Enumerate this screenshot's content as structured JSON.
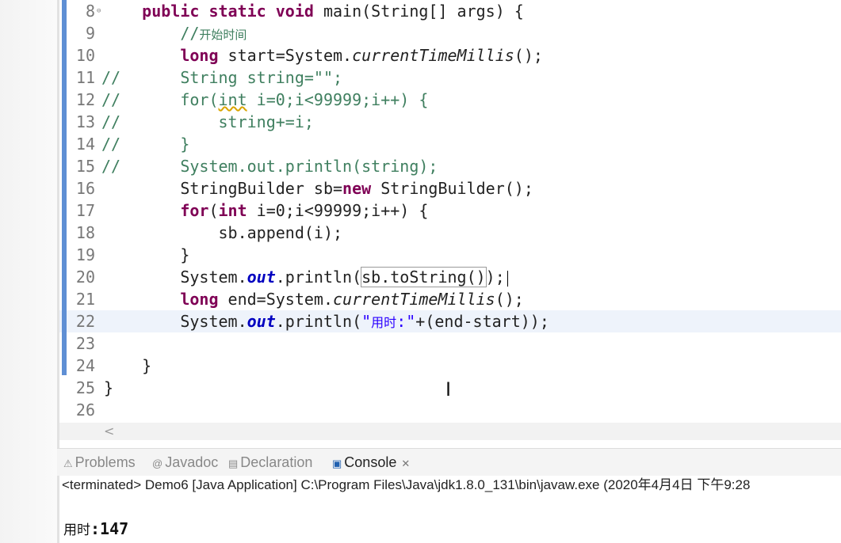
{
  "editor": {
    "lines": [
      {
        "num": "8",
        "marker": "⊖",
        "comment": "",
        "parts": [
          {
            "t": "    "
          },
          {
            "t": "public",
            "c": "kw"
          },
          {
            "t": " "
          },
          {
            "t": "static",
            "c": "kw"
          },
          {
            "t": " "
          },
          {
            "t": "void",
            "c": "kw"
          },
          {
            "t": " main(String[] args) {"
          }
        ]
      },
      {
        "num": "9",
        "comment": "",
        "parts": [
          {
            "t": "        "
          },
          {
            "t": "//",
            "c": "cmt"
          },
          {
            "t": "开始时间",
            "c": "cmt-cn"
          }
        ]
      },
      {
        "num": "10",
        "comment": "",
        "parts": [
          {
            "t": "        "
          },
          {
            "t": "long",
            "c": "kw"
          },
          {
            "t": " start=System."
          },
          {
            "t": "currentTimeMillis",
            "c": "ital"
          },
          {
            "t": "();"
          }
        ]
      },
      {
        "num": "11",
        "comment": "//",
        "parts": [
          {
            "t": "        String string=\"\";",
            "c": "cmt"
          }
        ]
      },
      {
        "num": "12",
        "comment": "//",
        "parts": [
          {
            "t": "        for(",
            "c": "cmt"
          },
          {
            "t": "int",
            "c": "cmt squiggle"
          },
          {
            "t": " i=0;i<99999;i++) {",
            "c": "cmt"
          }
        ]
      },
      {
        "num": "13",
        "comment": "//",
        "parts": [
          {
            "t": "            string+=i;",
            "c": "cmt"
          }
        ]
      },
      {
        "num": "14",
        "comment": "//",
        "parts": [
          {
            "t": "        }",
            "c": "cmt"
          }
        ]
      },
      {
        "num": "15",
        "comment": "//",
        "parts": [
          {
            "t": "        System.out.println(string);",
            "c": "cmt"
          }
        ]
      },
      {
        "num": "16",
        "comment": "",
        "parts": [
          {
            "t": "        StringBuilder sb="
          },
          {
            "t": "new",
            "c": "kw"
          },
          {
            "t": " StringBuilder();"
          }
        ]
      },
      {
        "num": "17",
        "comment": "",
        "parts": [
          {
            "t": "        "
          },
          {
            "t": "for",
            "c": "kw"
          },
          {
            "t": "("
          },
          {
            "t": "int",
            "c": "kw"
          },
          {
            "t": " i=0;i<99999;i++) {"
          }
        ]
      },
      {
        "num": "18",
        "comment": "",
        "parts": [
          {
            "t": "            sb.append(i);"
          }
        ]
      },
      {
        "num": "19",
        "comment": "",
        "parts": [
          {
            "t": "        }"
          }
        ]
      },
      {
        "num": "20",
        "comment": "",
        "caret": true,
        "parts": [
          {
            "t": "        System."
          },
          {
            "t": "out",
            "c": "fld"
          },
          {
            "t": ".println("
          },
          {
            "t": "sb.toString()",
            "c": "boxed"
          },
          {
            "t": ");"
          }
        ]
      },
      {
        "num": "21",
        "comment": "",
        "parts": [
          {
            "t": "        "
          },
          {
            "t": "long",
            "c": "kw"
          },
          {
            "t": " end=System."
          },
          {
            "t": "currentTimeMillis",
            "c": "ital"
          },
          {
            "t": "();"
          }
        ]
      },
      {
        "num": "22",
        "comment": "",
        "current": true,
        "parts": [
          {
            "t": "        System."
          },
          {
            "t": "out",
            "c": "fld"
          },
          {
            "t": ".println("
          },
          {
            "t": "\"",
            "c": "str"
          },
          {
            "t": "用时",
            "c": "str cn"
          },
          {
            "t": ":\"",
            "c": "str"
          },
          {
            "t": "+(end-start));"
          }
        ]
      },
      {
        "num": "23",
        "comment": "",
        "parts": []
      },
      {
        "num": "24",
        "comment": "",
        "parts": [
          {
            "t": "    }"
          }
        ]
      },
      {
        "num": "25",
        "comment": "",
        "parts": [
          {
            "t": "}"
          }
        ]
      },
      {
        "num": "26",
        "comment": "",
        "parts": []
      }
    ]
  },
  "scroll_arrow": "<",
  "cursor_glyph": "I",
  "tabs": [
    {
      "label": "Problems",
      "icon": "⚠",
      "icon_name": "problems-icon",
      "active": false
    },
    {
      "label": "Javadoc",
      "icon": "@",
      "icon_name": "javadoc-icon",
      "active": false
    },
    {
      "label": "Declaration",
      "icon": "▤",
      "icon_name": "declaration-icon",
      "active": false
    },
    {
      "label": "Console",
      "icon": "▣",
      "icon_name": "console-icon",
      "active": true,
      "close": "✕"
    }
  ],
  "console": {
    "header": "<terminated> Demo6 [Java Application] C:\\Program Files\\Java\\jdk1.8.0_131\\bin\\javaw.exe (2020年4月4日 下午9:28",
    "output_label": "用时",
    "output_value": ":147"
  },
  "colors": {
    "keyword": "#7f0055",
    "comment": "#3f7f5f",
    "string": "#2a00ff",
    "field": "#0000c0",
    "change_bar": "#5f8fd4"
  }
}
